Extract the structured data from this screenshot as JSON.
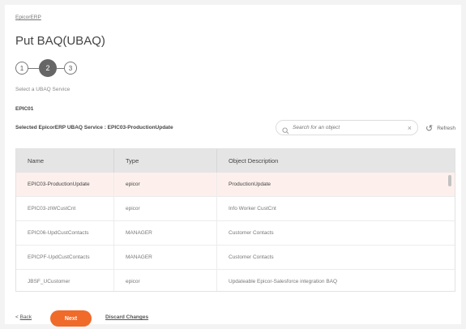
{
  "breadcrumb": "EpicorERP",
  "page_title": "Put BAQ(UBAQ)",
  "stepper": {
    "steps": [
      "1",
      "2",
      "3"
    ],
    "current": 2
  },
  "select_label": "Select a UBAQ Service",
  "connection_name": "EPIC01",
  "selected_service": "Selected EpicorERP UBAQ Service : EPIC03-ProductionUpdate",
  "search": {
    "placeholder": "Search for an object",
    "value": ""
  },
  "refresh_label": "Refresh",
  "table": {
    "headers": [
      "Name",
      "Type",
      "Object Description"
    ],
    "rows": [
      [
        "EPIC03-ProductionUpdate",
        "epicor",
        "ProductionUpdate"
      ],
      [
        "EPIC03-zIWCustCnt",
        "epicor",
        "Info Worker CustCnt"
      ],
      [
        "EPIC06-UpdCustContacts",
        "MANAGER",
        "Customer Contacts"
      ],
      [
        "EPICPF-UpdCustContacts",
        "MANAGER",
        "Customer Contacts"
      ],
      [
        "JBSF_UCustomer",
        "epicor",
        "Updateable Epicor-Salesforce integration BAQ"
      ]
    ],
    "selected_index": 0
  },
  "footer": {
    "back_chevron": "<",
    "back_label": "Back",
    "next_label": "Next",
    "discard_label": "Discard Changes"
  },
  "colors": {
    "accent": "#f06a2a",
    "selected_row": "#fdf0ec",
    "header_bg": "#e5e5e5"
  }
}
